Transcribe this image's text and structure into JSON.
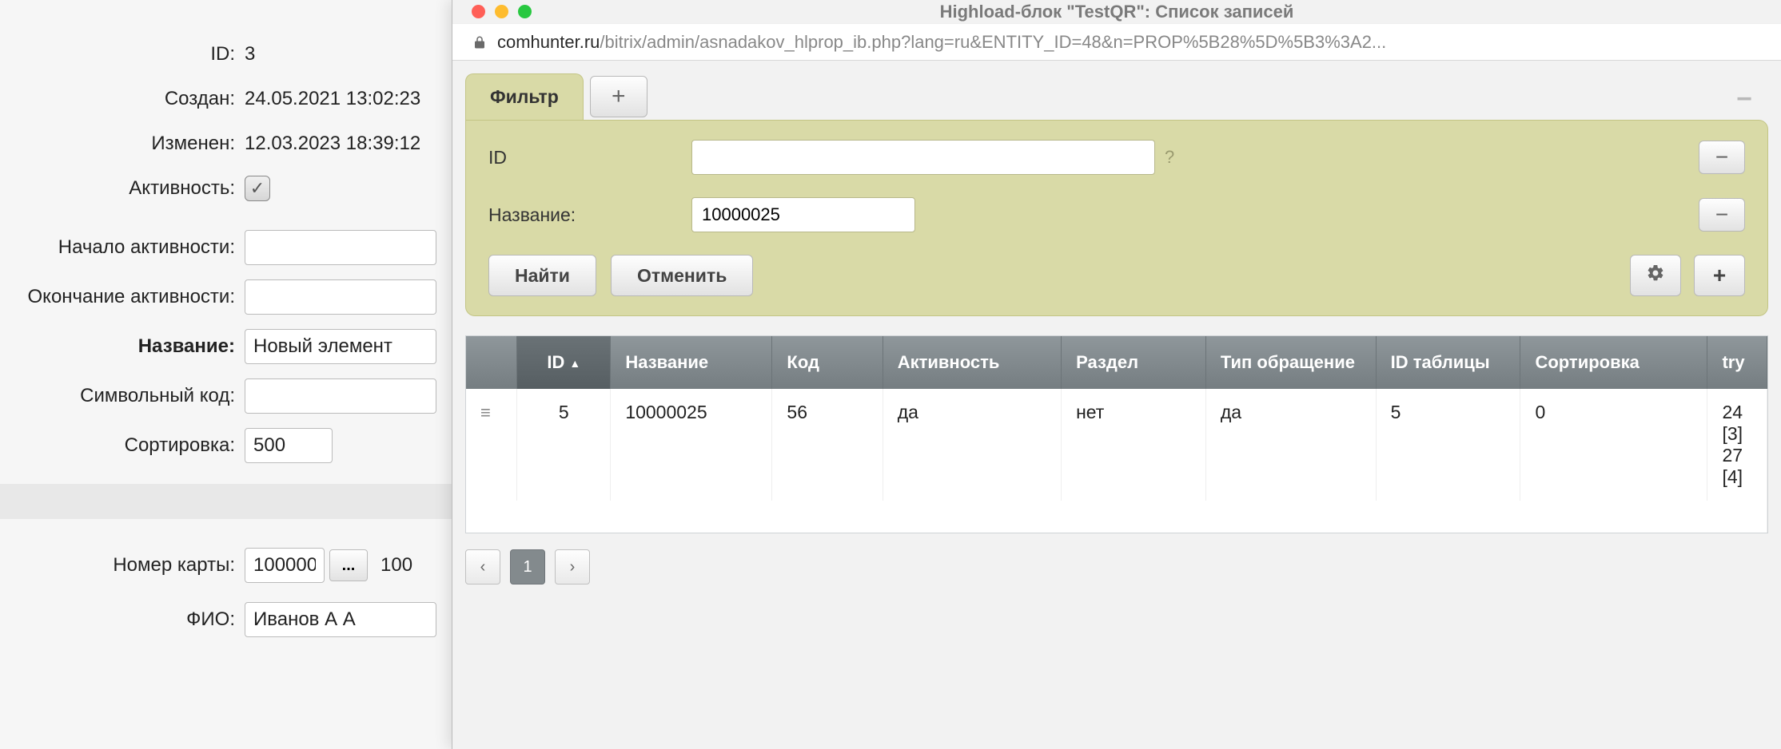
{
  "background_form": {
    "id_label": "ID:",
    "id_value": "3",
    "created_label": "Создан:",
    "created_value": "24.05.2021 13:02:23",
    "modified_label": "Изменен:",
    "modified_value": "12.03.2023 18:39:12",
    "active_label": "Активность:",
    "active_checked": true,
    "active_from_label": "Начало активности:",
    "active_from_value": "",
    "active_to_label": "Окончание активности:",
    "active_to_value": "",
    "name_label": "Название:",
    "name_value": "Новый элемент",
    "code_label": "Символьный код:",
    "code_value": "",
    "sort_label": "Сортировка:",
    "sort_value": "500",
    "card_label": "Номер карты:",
    "card_value": "100000",
    "card_lookup": "...",
    "card_after": "100",
    "fio_label": "ФИО:",
    "fio_value": "Иванов А А"
  },
  "window": {
    "title": "Highload-блок \"TestQR\": Список записей",
    "host": "comhunter.ru",
    "path": "/bitrix/admin/asnadakov_hlprop_ib.php?lang=ru&ENTITY_ID=48&n=PROP%5B28%5D%5B3%3A2..."
  },
  "filter": {
    "tab_label": "Фильтр",
    "id_label": "ID",
    "id_value": "",
    "name_label": "Название:",
    "name_value": "10000025",
    "find": "Найти",
    "cancel": "Отменить"
  },
  "table": {
    "columns": [
      "ID",
      "Название",
      "Код",
      "Активность",
      "Раздел",
      "Тип обращение",
      "ID таблицы",
      "Сортировка",
      "try"
    ],
    "sorted_col_index": 0,
    "row": {
      "id": "5",
      "name": "10000025",
      "code": "56",
      "active": "да",
      "section": "нет",
      "type": "да",
      "table_id": "5",
      "sort": "0",
      "extra": "24\n[3]\n27\n[4]"
    }
  },
  "pager": {
    "prev": "‹",
    "current": "1",
    "next": "›"
  }
}
